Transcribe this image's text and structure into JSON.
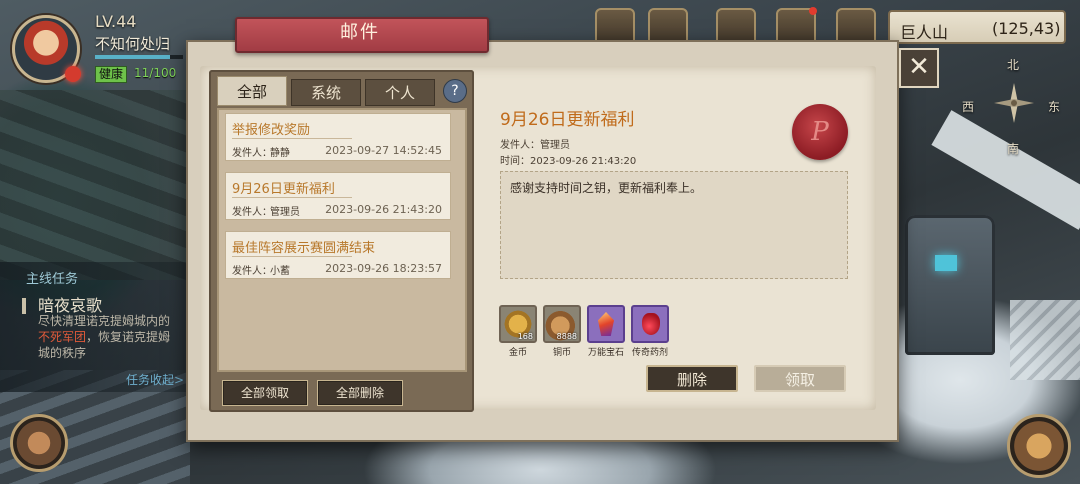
{
  "player": {
    "level": "LV.44",
    "name": "不知何处归",
    "xp_fraction": 0.85,
    "health_label": "健康",
    "health_value": "11/100"
  },
  "quest": {
    "header": "主线任务",
    "title": "暗夜哀歌",
    "desc_line1": "尽快清理诺克提姆城内的",
    "desc_line2_red": "不死军团",
    "desc_line2_rest": "，恢复诺克提姆",
    "desc_line3": "城的秩序",
    "link": "任务收起>"
  },
  "location": {
    "name": "巨人山",
    "coords": "(125,43)"
  },
  "compass": {
    "north": "北",
    "west": "西",
    "east": "东",
    "south": "南"
  },
  "dialog": {
    "title": "邮件",
    "close_icon": "close-icon"
  },
  "tabs": [
    {
      "label": "全部",
      "active": true
    },
    {
      "label": "系统",
      "active": false
    },
    {
      "label": "个人",
      "active": false
    }
  ],
  "help_label": "?",
  "sender_prefix": "发件人：",
  "time_prefix": "时间：",
  "mails": [
    {
      "subject": "举报修改奖励",
      "sender": "静静",
      "date": "2023-09-27 14:52:45"
    },
    {
      "subject": "9月26日更新福利",
      "sender": "管理员",
      "date": "2023-09-26 21:43:20"
    },
    {
      "subject": "最佳阵容展示赛圆满结束",
      "sender": "小蓄",
      "date": "2023-09-26 18:23:57"
    }
  ],
  "list_buttons": {
    "claim_all": "全部领取",
    "delete_all": "全部删除"
  },
  "detail": {
    "title": "9月26日更新福利",
    "sender": "管理员",
    "time": "2023-09-26 21:43:20",
    "body": "感谢支持时间之钥，更新福利奉上。",
    "seal_letter": "P"
  },
  "rewards": [
    {
      "name": "金币",
      "count": "168",
      "icon": "gold-coin-icon"
    },
    {
      "name": "铜币",
      "count": "8888",
      "icon": "copper-coin-icon"
    },
    {
      "name": "万能宝石",
      "count": "",
      "icon": "gem-icon"
    },
    {
      "name": "传奇药剂",
      "count": "",
      "icon": "potion-icon"
    }
  ],
  "actions": {
    "delete": "删除",
    "claim": "领取"
  }
}
